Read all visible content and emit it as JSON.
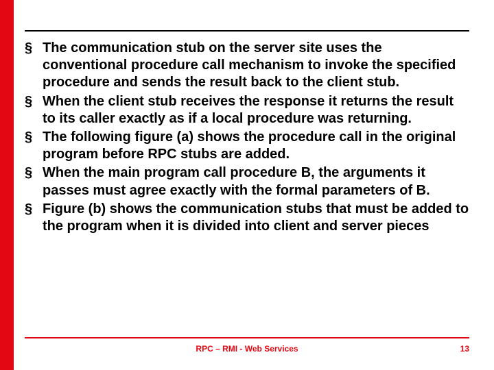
{
  "slide": {
    "bullets": [
      "The communication stub on the server site uses the conventional procedure call mechanism to invoke the specified procedure and sends the result back to the client stub.",
      "When the client stub receives the response it returns the result to its caller exactly as if a local procedure was returning.",
      "The following figure (a) shows the procedure call in the original program before RPC stubs are added.",
      "When the main program call procedure B, the arguments it passes must agree exactly with the formal parameters of B.",
      "Figure (b) shows the communication stubs that must be added to the program when it is divided into client and server pieces"
    ]
  },
  "footer": {
    "title": "RPC – RMI - Web Services",
    "page": "13"
  },
  "colors": {
    "accent": "#e30613"
  }
}
